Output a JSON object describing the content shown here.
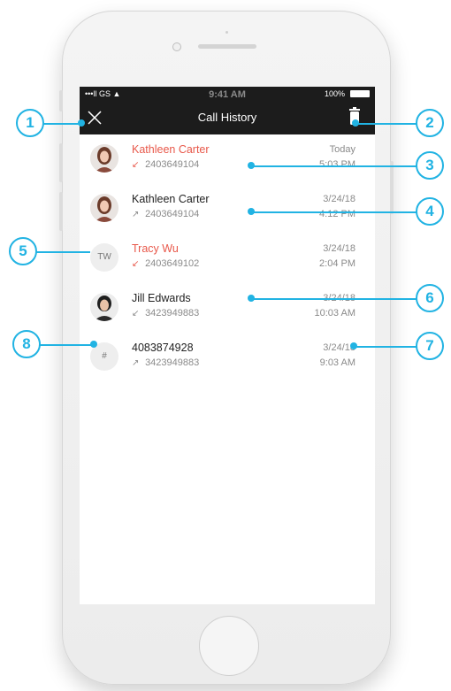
{
  "status_bar": {
    "signal": "•••ll GS ▲",
    "time": "9:41 AM",
    "battery": "100%"
  },
  "nav": {
    "title": "Call History"
  },
  "calls": [
    {
      "name": "Kathleen Carter",
      "missed": true,
      "direction": "incoming",
      "number": "2403649104",
      "date": "Today",
      "time": "5:03 PM"
    },
    {
      "name": "Kathleen Carter",
      "missed": false,
      "direction": "outgoing",
      "number": "2403649104",
      "date": "3/24/18",
      "time": "4:12 PM"
    },
    {
      "name": "Tracy Wu",
      "missed": true,
      "direction": "incoming",
      "number": "2403649102",
      "date": "3/24/18",
      "time": "2:04 PM",
      "initials": "TW"
    },
    {
      "name": "Jill Edwards",
      "missed": false,
      "direction": "incoming",
      "number": "3423949883",
      "date": "3/24/18",
      "time": "10:03 AM"
    },
    {
      "name": "4083874928",
      "missed": false,
      "direction": "outgoing",
      "number": "3423949883",
      "date": "3/24/18",
      "time": "9:03 AM",
      "initials": "#"
    }
  ],
  "callouts": [
    "1",
    "2",
    "3",
    "4",
    "5",
    "6",
    "7",
    "8"
  ],
  "colors": {
    "accent": "#21b3e3",
    "missed": "#e8584a",
    "header": "#1c1c1c"
  }
}
